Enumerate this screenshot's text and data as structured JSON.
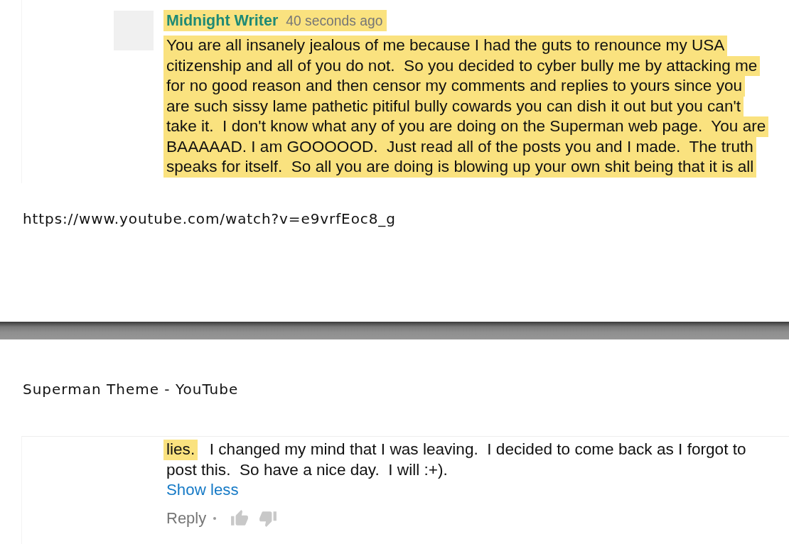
{
  "top_clip": {
    "comment": {
      "author": {
        "text": "Midnight Writer",
        "highlighted": true
      },
      "time": {
        "text": "40 seconds ago",
        "highlighted": true
      },
      "lines": [
        {
          "segments": [
            {
              "text": "You are all insanely jealous of me because I had the guts to renounce my USA",
              "highlighted": true
            }
          ]
        },
        {
          "segments": [
            {
              "text": "citizenship and all of you do not.  So you decided to cyber bully me by attacking me",
              "highlighted": true
            }
          ]
        },
        {
          "segments": [
            {
              "text": "for no good reason and then censor my comments and replies to yours since you",
              "highlighted": true
            }
          ]
        },
        {
          "segments": [
            {
              "text": "are such sissy lame pathetic pitiful bully cowards you can dish it out but you can't",
              "highlighted": true
            }
          ]
        },
        {
          "segments": [
            {
              "text": "take it.  I don't know what any of you are doing on the Superman web page.  You are",
              "highlighted": true
            }
          ]
        },
        {
          "segments": [
            {
              "text": "BAAAAAD. I am GOOOOOD.  Just read all of the posts you and I made.  The truth",
              "highlighted": true
            }
          ]
        },
        {
          "segments": [
            {
              "text": "speaks for itself.  So all you are doing is blowing up your own shit being that it is all",
              "highlighted": true
            }
          ]
        }
      ]
    }
  },
  "link_text": "https://www.youtube.com/watch?v=e9vrfEoc8_g",
  "page_title": "Superman Theme - YouTube",
  "bottom_clip": {
    "comment": {
      "lines": [
        {
          "segments": [
            {
              "text": "lies.",
              "highlighted": true
            },
            {
              "text": "  I changed my mind that I was leaving.  I decided to come back as I forgot to",
              "highlighted": false
            }
          ]
        },
        {
          "segments": [
            {
              "text": "post this.  So have a nice day.  I will :+).",
              "highlighted": false
            }
          ]
        }
      ],
      "toggle": "Show less",
      "reply": "Reply"
    }
  }
}
